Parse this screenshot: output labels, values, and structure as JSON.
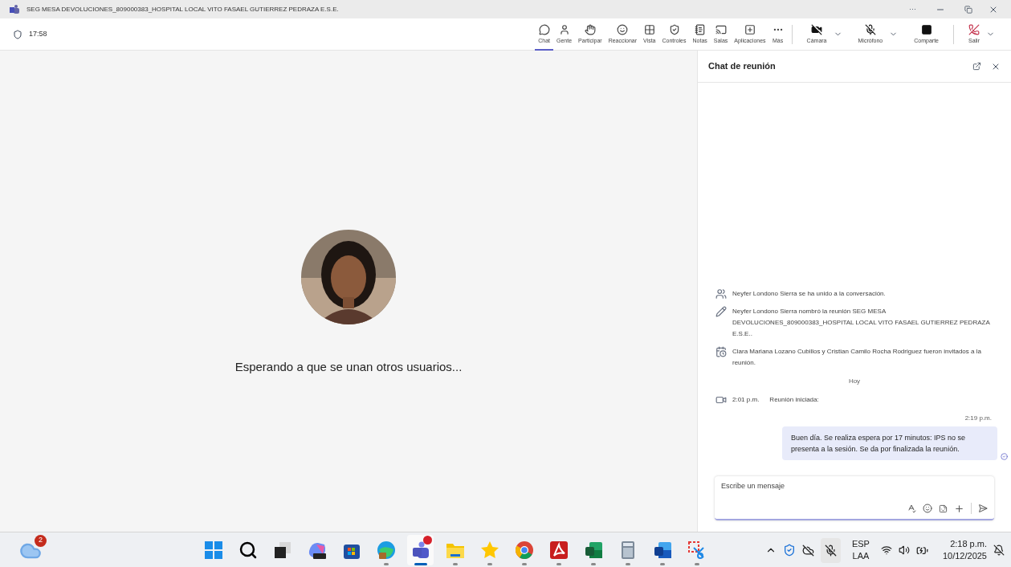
{
  "window": {
    "title": "SEG MESA DEVOLUCIONES_809000383_HOSPITAL LOCAL VITO FASAEL GUTIERREZ PEDRAZA E.S.E.",
    "controls": [
      "···"
    ]
  },
  "meeting_bar": {
    "timer": "17:58",
    "items": [
      {
        "label": "Chat",
        "kind": "plain",
        "selected": true
      },
      {
        "label": "Gente",
        "kind": "plain",
        "selected": false
      },
      {
        "label": "Participar",
        "kind": "plain",
        "selected": false
      },
      {
        "label": "Reaccionar",
        "kind": "plain",
        "selected": false
      },
      {
        "label": "Vista",
        "kind": "plain",
        "selected": false
      },
      {
        "label": "Controles",
        "kind": "plain",
        "selected": false
      },
      {
        "label": "Notas",
        "kind": "plain",
        "selected": false
      },
      {
        "label": "Salas",
        "kind": "plain",
        "selected": false
      },
      {
        "label": "Aplicaciones",
        "kind": "plain",
        "selected": false
      },
      {
        "label": "Más",
        "kind": "plain",
        "selected": false
      },
      {
        "label": "Cámara",
        "kind": "dropdown",
        "selected": false
      },
      {
        "label": "Micrófono",
        "kind": "dropdown",
        "selected": false
      },
      {
        "label": "Comparte",
        "kind": "plain",
        "selected": false
      },
      {
        "label": "Salir",
        "kind": "leave",
        "selected": false
      }
    ]
  },
  "stage": {
    "status": "Esperando a que se unan otros usuarios..."
  },
  "chat": {
    "title": "Chat de reunión",
    "events": [
      {
        "kind": "joined",
        "text": "Neyfer Londono Sierra se ha unido a la conversación."
      },
      {
        "kind": "renamed",
        "text": "Neyfer Londono Sierra nombró la reunión SEG MESA DEVOLUCIONES_809000383_HOSPITAL LOCAL VITO FASAEL GUTIERREZ PEDRAZA E.S.E.."
      },
      {
        "kind": "invited",
        "text": "Clara Mariana Lozano Cubillos y Cristian Camilo Rocha Rodriguez fueron invitados a la reunión."
      },
      {
        "kind": "date",
        "text": "Hoy"
      },
      {
        "kind": "meeting",
        "time": "2:01 p.m.",
        "text": "Reunión iniciada:"
      }
    ],
    "message": {
      "time": "2:19 p.m.",
      "text": "Buen día. Se realiza espera por 17 minutos: IPS no se presenta a la sesión. Se da por finalizada la reunión."
    },
    "composer": {
      "placeholder": "Escribe un mensaje"
    }
  },
  "taskbar": {
    "weather_badge": "2",
    "apps": [
      {
        "kind": "start",
        "running": false,
        "selected": false
      },
      {
        "kind": "search",
        "running": false,
        "selected": false
      },
      {
        "kind": "taskview",
        "running": false,
        "selected": false
      },
      {
        "kind": "m365",
        "running": false,
        "selected": false
      },
      {
        "kind": "store",
        "running": false,
        "selected": false
      },
      {
        "kind": "edge",
        "running": true,
        "selected": false
      },
      {
        "kind": "teams",
        "running": true,
        "selected": true
      },
      {
        "kind": "folder",
        "running": true,
        "selected": false
      },
      {
        "kind": "star",
        "running": true,
        "selected": false
      },
      {
        "kind": "chrome",
        "running": true,
        "selected": false
      },
      {
        "kind": "pdf",
        "running": true,
        "selected": false
      },
      {
        "kind": "excel",
        "running": true,
        "selected": false
      },
      {
        "kind": "calculator",
        "running": true,
        "selected": false
      },
      {
        "kind": "word",
        "running": true,
        "selected": false
      },
      {
        "kind": "snip",
        "running": true,
        "selected": false
      }
    ],
    "language": "ESP",
    "layout": "LAA",
    "time": "2:18 p.m.",
    "date": "10/12/2025"
  }
}
